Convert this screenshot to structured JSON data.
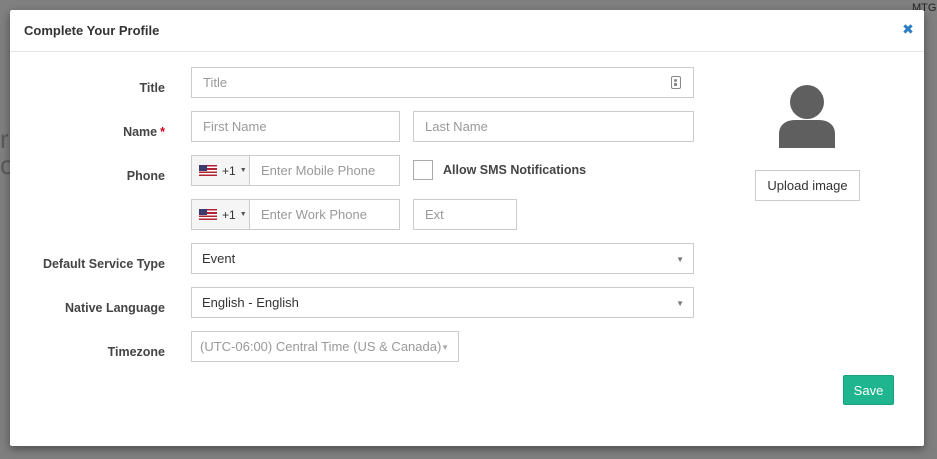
{
  "backdrop": {
    "tag": "MTG"
  },
  "modal": {
    "title": "Complete Your Profile",
    "close_icon": "close-icon"
  },
  "form": {
    "title": {
      "label": "Title",
      "placeholder": "Title"
    },
    "name": {
      "label": "Name",
      "required_mark": "*",
      "first_placeholder": "First Name",
      "last_placeholder": "Last Name"
    },
    "phone": {
      "label": "Phone",
      "mobile": {
        "country_code": "+1",
        "placeholder": "Enter Mobile Phone"
      },
      "work": {
        "country_code": "+1",
        "placeholder": "Enter Work Phone"
      },
      "ext_placeholder": "Ext",
      "sms_label": "Allow SMS Notifications",
      "sms_checked": false
    },
    "service_type": {
      "label": "Default Service Type",
      "value": "Event"
    },
    "language": {
      "label": "Native Language",
      "value": "English - English"
    },
    "timezone": {
      "label": "Timezone",
      "value": "(UTC-06:00) Central Time (US & Canada)",
      "disabled": true
    }
  },
  "avatar": {
    "upload_label": "Upload image"
  },
  "actions": {
    "save_label": "Save"
  },
  "colors": {
    "accent": "#1fb68f",
    "close": "#2a7ec4",
    "required": "#d0021b",
    "avatar": "#5f5f5f"
  }
}
